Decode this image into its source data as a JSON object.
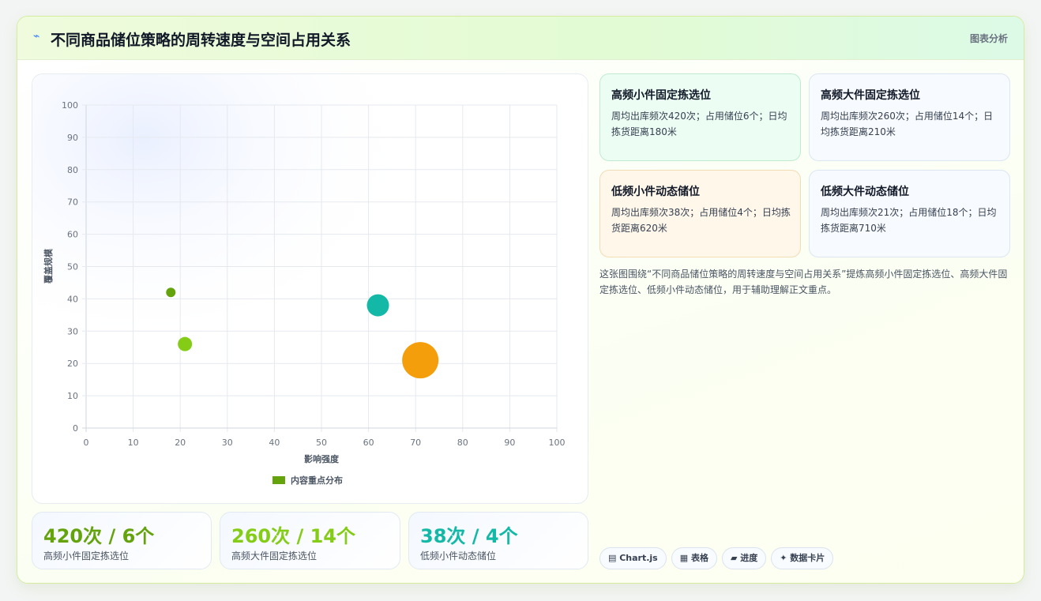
{
  "header": {
    "icon": "⌁",
    "title": "不同商品储位策略的周转速度与空间占用关系",
    "tag": "图表分析"
  },
  "chart_data": {
    "type": "scatter",
    "xlabel": "影响强度",
    "ylabel": "覆盖规模",
    "xlim": [
      0,
      100
    ],
    "ylim": [
      0,
      100
    ],
    "xticks": [
      0,
      10,
      20,
      30,
      40,
      50,
      60,
      70,
      80,
      90,
      100
    ],
    "yticks": [
      0,
      10,
      20,
      30,
      40,
      50,
      60,
      70,
      80,
      90,
      100
    ],
    "grid": true,
    "legend_position": "bottom",
    "series": [
      {
        "name": "内容重点分布",
        "color": "#65a30d",
        "points": [
          {
            "x": 18,
            "y": 42,
            "r": 6,
            "color": "#65a30d"
          },
          {
            "x": 21,
            "y": 26,
            "r": 9,
            "color": "#84cc16"
          },
          {
            "x": 62,
            "y": 38,
            "r": 14,
            "color": "#14b8a6"
          },
          {
            "x": 71,
            "y": 21,
            "r": 23,
            "color": "#f59e0b"
          }
        ]
      }
    ]
  },
  "stats": [
    {
      "value": "420次 / 6个",
      "label": "高频小件固定拣选位",
      "color": "#65a30d"
    },
    {
      "value": "260次 / 14个",
      "label": "高频大件固定拣选位",
      "color": "#84cc16"
    },
    {
      "value": "38次 / 4个",
      "label": "低频小件动态储位",
      "color": "#14b8a6"
    }
  ],
  "info_cards": [
    {
      "title": "高频小件固定拣选位",
      "text": "周均出库频次420次；占用储位6个；日均拣货距离180米",
      "bg": "#ecfdf3",
      "border": "#bfeccf"
    },
    {
      "title": "高频大件固定拣选位",
      "text": "周均出库频次260次；占用储位14个；日均拣货距离210米",
      "bg": "#f6f9fe",
      "border": "#dbe5f2"
    },
    {
      "title": "低频小件动态储位",
      "text": "周均出库频次38次；占用储位4个；日均拣货距离620米",
      "bg": "#fff7ea",
      "border": "#f2dcb4"
    },
    {
      "title": "低频大件动态储位",
      "text": "周均出库频次21次；占用储位18个；日均拣货距离710米",
      "bg": "#f6f9fe",
      "border": "#dbe5f2"
    }
  ],
  "summary": "这张图围绕“不同商品储位策略的周转速度与空间占用关系”提炼高频小件固定拣选位、高频大件固定拣选位、低频小件动态储位，用于辅助理解正文重点。",
  "pills": [
    "▤ Chart.js",
    "▦ 表格",
    "▰ 进度",
    "✦ 数据卡片"
  ]
}
